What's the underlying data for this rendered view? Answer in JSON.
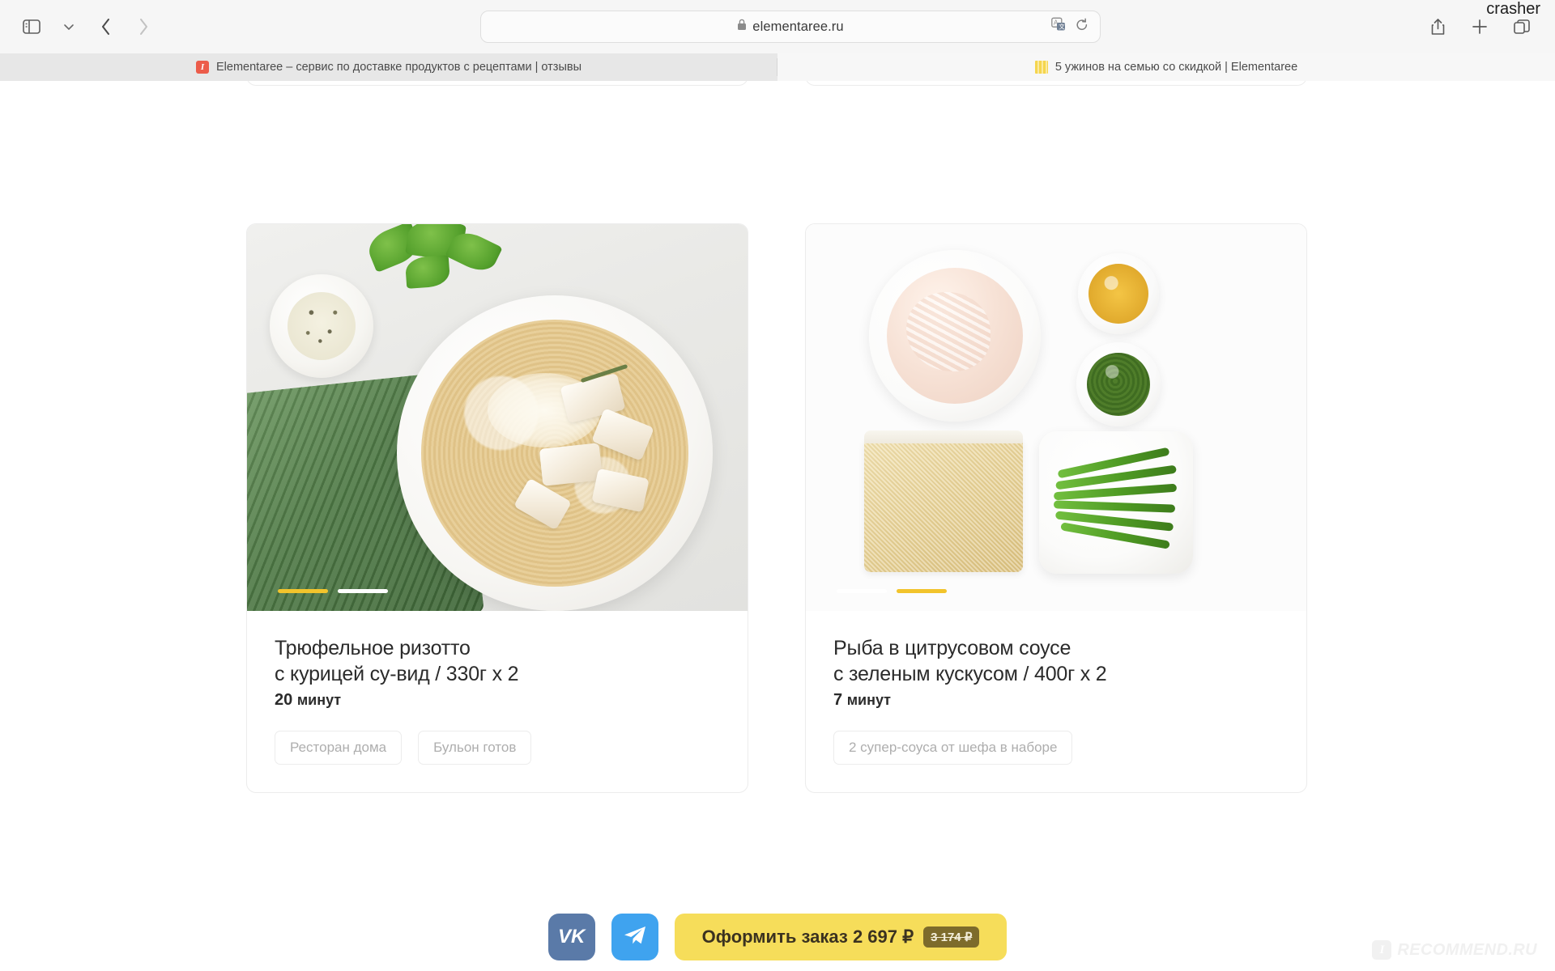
{
  "browser": {
    "url": "elementaree.ru",
    "lock_icon": "lock-icon",
    "sidebar_icon": "sidebar-toggle-icon",
    "chevron_icon": "chevron-down-icon",
    "back_icon": "back-arrow-icon",
    "forward_icon": "forward-arrow-icon",
    "shield_icon": "privacy-shield-icon",
    "translate_icon": "translate-icon",
    "reload_icon": "reload-icon",
    "share_icon": "share-icon",
    "new_tab_icon": "plus-icon",
    "tabs_overview_icon": "tabs-overview-icon",
    "overlay_label": "crasher",
    "tabs": [
      {
        "title": "Elementaree – сервис по доставке продуктов с рецептами | отзывы",
        "favicon": "irecommend-favicon",
        "active": true
      },
      {
        "title": "5 ужинов на семью со скидкой | Elementaree",
        "favicon": "elementaree-favicon",
        "active": false
      }
    ]
  },
  "dishes": [
    {
      "title_line1": "Трюфельное ризотто",
      "title_line2": "с курицей су-вид / 330г х 2",
      "time_value": "20",
      "time_unit": "минут",
      "tags": [
        "Ресторан дома",
        "Бульон готов"
      ],
      "slides": 2,
      "active_slide": 1
    },
    {
      "title_line1": "Рыба в цитрусовом соусе",
      "title_line2": "с зеленым кускусом / 400г х 2",
      "time_value": "7",
      "time_unit": "минут",
      "tags": [
        "2 супер-соуса от шефа в наборе"
      ],
      "slides": 2,
      "active_slide": 2
    }
  ],
  "bottom_bar": {
    "vk_label": "VK",
    "telegram_icon": "telegram-icon",
    "cta_label": "Оформить заказ 2 697 ₽",
    "cta_old_price": "3 174 ₽",
    "cta_color": "#f6dd5a"
  },
  "watermark": {
    "badge": "I",
    "text": "RECOMMEND.RU"
  }
}
